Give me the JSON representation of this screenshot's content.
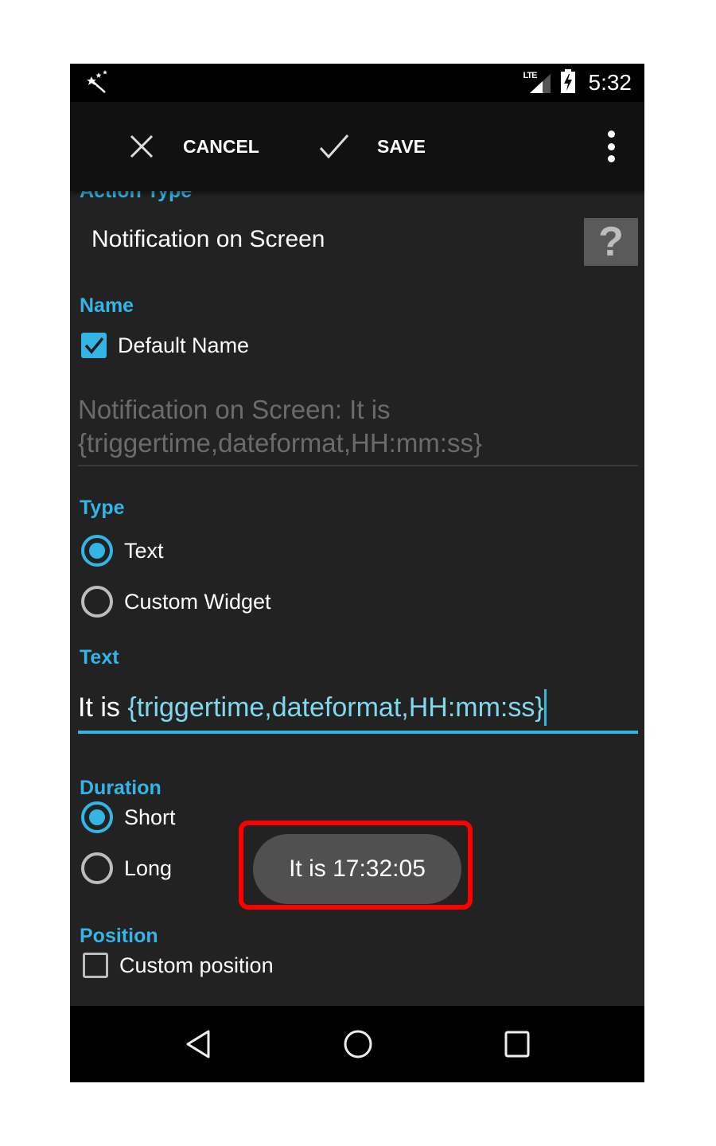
{
  "status_bar": {
    "app_icon": "magic-wand-icon",
    "network_label": "LTE",
    "signal_icon": "signal-icon",
    "battery_icon": "battery-charging-icon",
    "time": "5:32"
  },
  "toolbar": {
    "cancel_icon": "close-icon",
    "cancel_label": "CANCEL",
    "save_icon": "check-icon",
    "save_label": "SAVE",
    "overflow_icon": "more-vert-icon"
  },
  "form": {
    "action_type": {
      "label": "Action Type",
      "value": "Notification on Screen",
      "help_label": "?"
    },
    "name": {
      "label": "Name",
      "default_name_checkbox": {
        "label": "Default Name",
        "checked": true
      },
      "field_value": "Notification on Screen: It is {triggertime,dateformat,HH:mm:ss}"
    },
    "type": {
      "label": "Type",
      "options": [
        {
          "label": "Text",
          "selected": true
        },
        {
          "label": "Custom Widget",
          "selected": false
        }
      ]
    },
    "text": {
      "label": "Text",
      "value_plain": "It is ",
      "value_variable": "{triggertime,dateformat,HH:mm:ss}"
    },
    "duration": {
      "label": "Duration",
      "options": [
        {
          "label": "Short",
          "selected": true
        },
        {
          "label": "Long",
          "selected": false
        }
      ]
    },
    "position": {
      "label": "Position",
      "custom_position_checkbox": {
        "label": "Custom position",
        "checked": false
      }
    }
  },
  "toast": {
    "message": "It is 17:32:05",
    "highlight_color": "#ff0000"
  },
  "colors": {
    "accent": "#33b5e5",
    "background": "#222222",
    "toolbar": "#111111"
  },
  "nav_bar": {
    "back_icon": "back-icon",
    "home_icon": "home-icon",
    "recents_icon": "recents-icon"
  }
}
